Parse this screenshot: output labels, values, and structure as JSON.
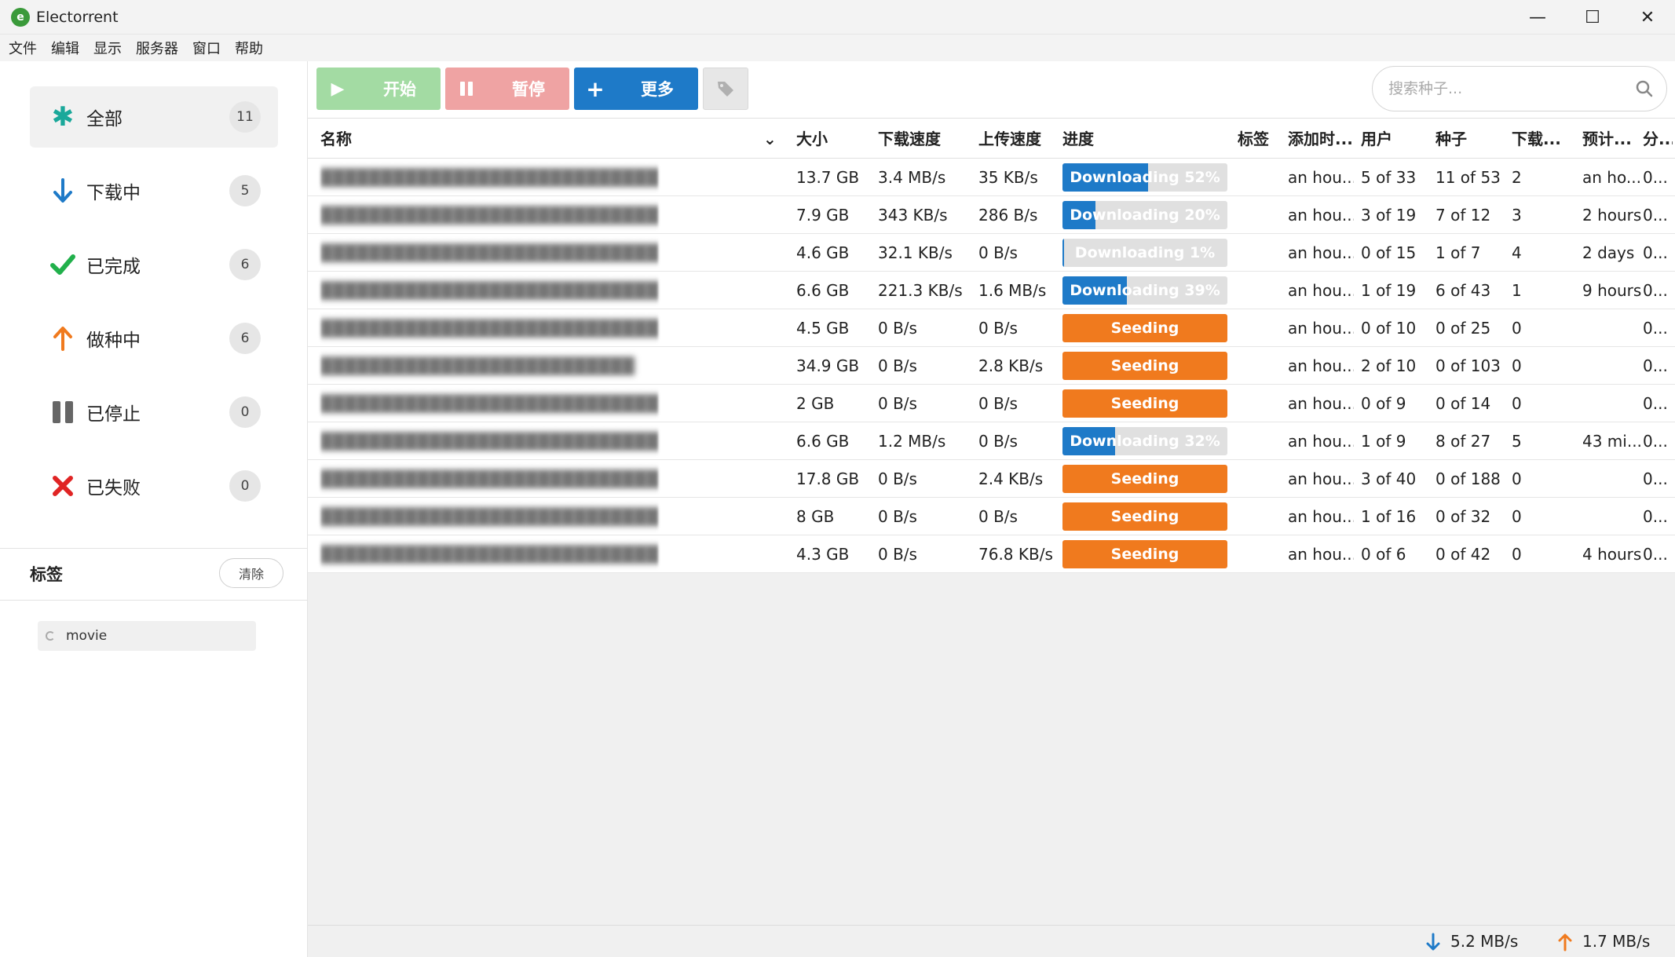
{
  "app": {
    "title": "Electorrent"
  },
  "menu": [
    "文件",
    "编辑",
    "显示",
    "服务器",
    "窗口",
    "帮助"
  ],
  "sidebar": {
    "filters": [
      {
        "label": "全部",
        "count": "11",
        "icon": "asterisk-icon",
        "color": "#1aa89a"
      },
      {
        "label": "下载中",
        "count": "5",
        "icon": "arrow-down-icon",
        "color": "#1e7ac8"
      },
      {
        "label": "已完成",
        "count": "6",
        "icon": "check-icon",
        "color": "#21b04b"
      },
      {
        "label": "做种中",
        "count": "6",
        "icon": "arrow-up-icon",
        "color": "#f07a1e"
      },
      {
        "label": "已停止",
        "count": "0",
        "icon": "pause-icon",
        "color": "#666666"
      },
      {
        "label": "已失败",
        "count": "0",
        "icon": "x-icon",
        "color": "#e02424"
      }
    ],
    "tags_title": "标签",
    "tags_clear": "清除",
    "tags": [
      "movie"
    ]
  },
  "toolbar": {
    "start_label": "开始",
    "pause_label": "暂停",
    "more_label": "更多",
    "search_placeholder": "搜索种子..."
  },
  "table": {
    "columns": [
      "名称",
      "大小",
      "下载速度",
      "上传速度",
      "进度",
      "标签",
      "添加时...",
      "用户",
      "种子",
      "下载...",
      "预计...",
      "分..."
    ],
    "rows": [
      {
        "name": "████████████████████████████████████████",
        "size": "13.7 GB",
        "down": "3.4 MB/s",
        "up": "35 KB/s",
        "status": "downloading",
        "progress_label": "Downloading 52%",
        "progress": 0.52,
        "tag": "",
        "added": "an hou...",
        "peers": "5 of 33",
        "seeds": "11 of 53",
        "dl": "2",
        "eta": "an ho...",
        "share": "0..."
      },
      {
        "name": "████████████████████████████████████████",
        "size": "7.9 GB",
        "down": "343 KB/s",
        "up": "286 B/s",
        "status": "downloading",
        "progress_label": "Downloading 20%",
        "progress": 0.2,
        "tag": "",
        "added": "an hou...",
        "peers": "3 of 19",
        "seeds": "7 of 12",
        "dl": "3",
        "eta": "2 hours",
        "share": "0..."
      },
      {
        "name": "█████████████████████████████████",
        "size": "4.6 GB",
        "down": "32.1 KB/s",
        "up": "0 B/s",
        "status": "downloading",
        "progress_label": "Downloading 1%",
        "progress": 0.01,
        "tag": "",
        "added": "an hou...",
        "peers": "0 of 15",
        "seeds": "1 of 7",
        "dl": "4",
        "eta": "2 days",
        "share": "0..."
      },
      {
        "name": "████████████████████████████████████████",
        "size": "6.6 GB",
        "down": "221.3 KB/s",
        "up": "1.6 MB/s",
        "status": "downloading",
        "progress_label": "Downloading 39%",
        "progress": 0.39,
        "tag": "",
        "added": "an hou...",
        "peers": "1 of 19",
        "seeds": "6 of 43",
        "dl": "1",
        "eta": "9 hours",
        "share": "0..."
      },
      {
        "name": "████████████████████████████████████████",
        "size": "4.5 GB",
        "down": "0 B/s",
        "up": "0 B/s",
        "status": "seeding",
        "progress_label": "Seeding",
        "progress": 1,
        "tag": "",
        "added": "an hou...",
        "peers": "0 of 10",
        "seeds": "0 of 25",
        "dl": "0",
        "eta": "",
        "share": "0..."
      },
      {
        "name": "██████████████████████████",
        "size": "34.9 GB",
        "down": "0 B/s",
        "up": "2.8 KB/s",
        "status": "seeding",
        "progress_label": "Seeding",
        "progress": 1,
        "tag": "",
        "added": "an hou...",
        "peers": "2 of 10",
        "seeds": "0 of 103",
        "dl": "0",
        "eta": "",
        "share": "0..."
      },
      {
        "name": "████████████████████████████████████████",
        "size": "2 GB",
        "down": "0 B/s",
        "up": "0 B/s",
        "status": "seeding",
        "progress_label": "Seeding",
        "progress": 1,
        "tag": "",
        "added": "an hou...",
        "peers": "0 of 9",
        "seeds": "0 of 14",
        "dl": "0",
        "eta": "",
        "share": "0..."
      },
      {
        "name": "████████████████████████████████",
        "size": "6.6 GB",
        "down": "1.2 MB/s",
        "up": "0 B/s",
        "status": "downloading",
        "progress_label": "Downloading 32%",
        "progress": 0.32,
        "tag": "",
        "added": "an hou...",
        "peers": "1 of 9",
        "seeds": "8 of 27",
        "dl": "5",
        "eta": "43 mi...",
        "share": "0..."
      },
      {
        "name": "████████████████████████████████████████",
        "size": "17.8 GB",
        "down": "0 B/s",
        "up": "2.4 KB/s",
        "status": "seeding",
        "progress_label": "Seeding",
        "progress": 1,
        "tag": "",
        "added": "an hou...",
        "peers": "3 of 40",
        "seeds": "0 of 188",
        "dl": "0",
        "eta": "",
        "share": "0..."
      },
      {
        "name": "████████████████████████████████████████",
        "size": "8 GB",
        "down": "0 B/s",
        "up": "0 B/s",
        "status": "seeding",
        "progress_label": "Seeding",
        "progress": 1,
        "tag": "",
        "added": "an hou...",
        "peers": "1 of 16",
        "seeds": "0 of 32",
        "dl": "0",
        "eta": "",
        "share": "0..."
      },
      {
        "name": "██████████████████████████████████",
        "size": "4.3 GB",
        "down": "0 B/s",
        "up": "76.8 KB/s",
        "status": "seeding",
        "progress_label": "Seeding",
        "progress": 1,
        "tag": "",
        "added": "an hou...",
        "peers": "0 of 6",
        "seeds": "0 of 42",
        "dl": "0",
        "eta": "4 hours",
        "share": "0..."
      }
    ]
  },
  "statusbar": {
    "down_speed": "5.2 MB/s",
    "up_speed": "1.7 MB/s"
  },
  "colors": {
    "download_blue": "#1e7ac8",
    "seeding_orange": "#f07a1e",
    "start_green": "#a3dba3",
    "pause_red": "#efa3a3"
  }
}
